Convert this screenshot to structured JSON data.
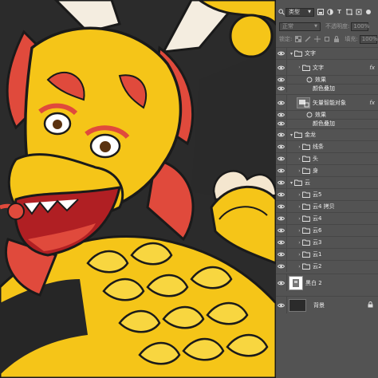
{
  "panel": {
    "filter_kind": "类型",
    "blend_mode": "正常",
    "opacity_label": "不透明度:",
    "opacity_value": "100%",
    "lock_label": "锁定:",
    "fill_label": "填充:",
    "fill_value": "100%"
  },
  "layers": [
    {
      "name": "文字",
      "kind": "group"
    },
    {
      "name": "文字",
      "kind": "text",
      "fx": "fx"
    },
    {
      "name": "效果",
      "kind": "effects"
    },
    {
      "name": "颜色叠加",
      "kind": "effect"
    },
    {
      "name": "矢量智能对象",
      "kind": "smart",
      "fx": "fx"
    },
    {
      "name": "效果",
      "kind": "effects"
    },
    {
      "name": "颜色叠加",
      "kind": "effect"
    },
    {
      "name": "金龙",
      "kind": "group"
    },
    {
      "name": "线条",
      "kind": "group-nested"
    },
    {
      "name": "头",
      "kind": "group-nested"
    },
    {
      "name": "身",
      "kind": "group-nested"
    },
    {
      "name": "云",
      "kind": "group"
    },
    {
      "name": "云5",
      "kind": "group-nested"
    },
    {
      "name": "云4 拷贝",
      "kind": "group-nested"
    },
    {
      "name": "云4",
      "kind": "group-nested"
    },
    {
      "name": "云6",
      "kind": "group-nested"
    },
    {
      "name": "云3",
      "kind": "group-nested"
    },
    {
      "name": "云1",
      "kind": "group-nested"
    },
    {
      "name": "云2",
      "kind": "group-nested"
    },
    {
      "name": "黑白 2",
      "kind": "pixel"
    },
    {
      "name": "背景",
      "kind": "background"
    }
  ],
  "colors": {
    "panel_bg": "#535353",
    "canvas_bg": "#2b2b2b",
    "dragon_yellow": "#f5c518",
    "dragon_red": "#e04a3c",
    "horn_white": "#f4ede0"
  }
}
